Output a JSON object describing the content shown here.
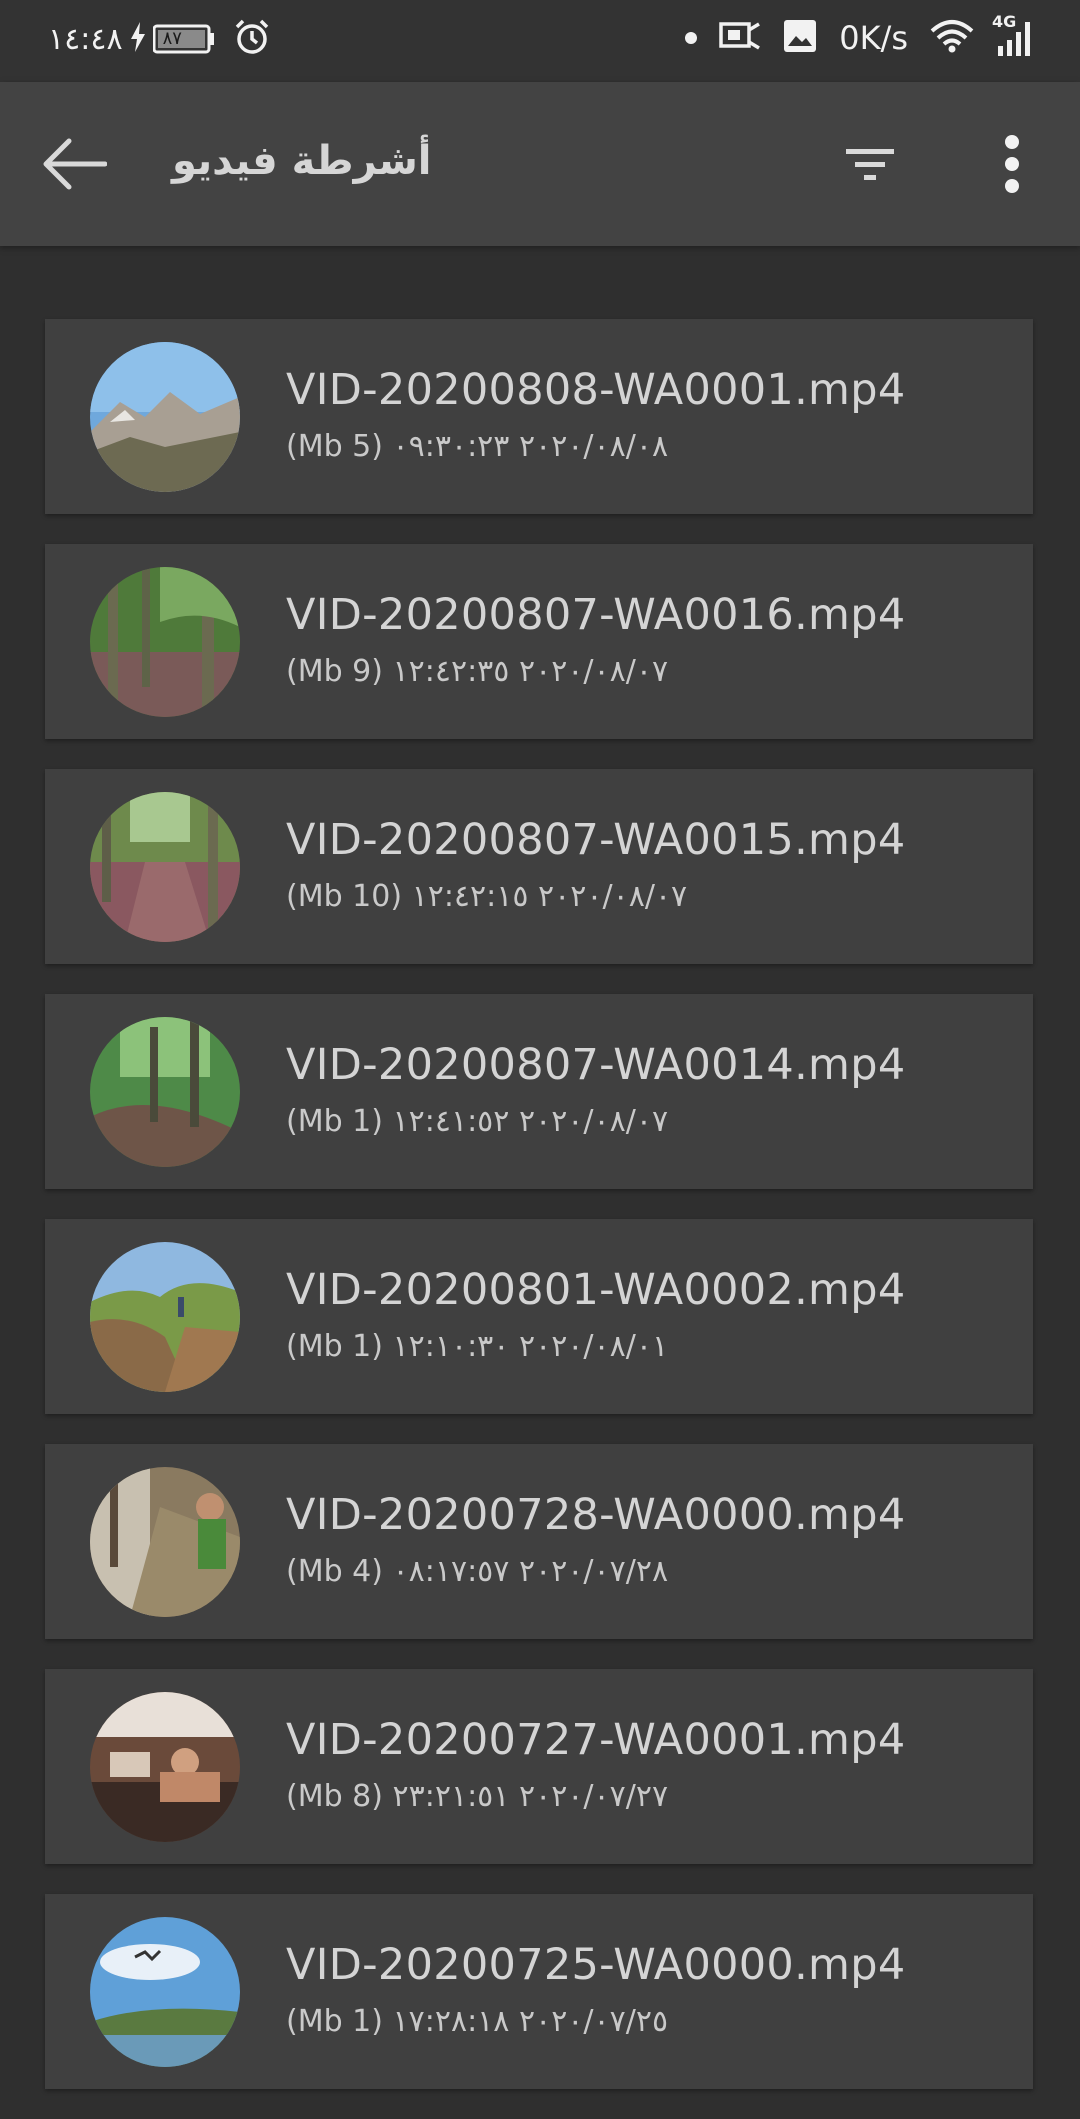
{
  "status_bar": {
    "time": "١٤:٤٨",
    "battery": "٨٧",
    "net_speed": "0K/s",
    "network": "4G",
    "icons": [
      "charging-bolt-icon",
      "battery-icon",
      "alarm-icon",
      "dot-icon",
      "screen-share-icon",
      "image-icon",
      "wifi-icon",
      "cellular-signal-icon"
    ]
  },
  "app_bar": {
    "title": "أشرطة فيديو",
    "back_icon": "arrow-back-icon",
    "filter_icon": "filter-list-icon",
    "more_icon": "more-vert-icon"
  },
  "videos": [
    {
      "name": "VID-20200808-WA0001.mp4",
      "size": "(Mb 5)",
      "datetime": "٢٠٢٠/٠٨/٠٨ ٠٩:٣٠:٢٣",
      "thumb": "mountains"
    },
    {
      "name": "VID-20200807-WA0016.mp4",
      "size": "(Mb 9)",
      "datetime": "٢٠٢٠/٠٨/٠٧ ١٢:٤٢:٣٥",
      "thumb": "forest-trail"
    },
    {
      "name": "VID-20200807-WA0015.mp4",
      "size": "(Mb 10)",
      "datetime": "٢٠٢٠/٠٨/٠٧ ١٢:٤٢:١٥",
      "thumb": "forest-path"
    },
    {
      "name": "VID-20200807-WA0014.mp4",
      "size": "(Mb 1)",
      "datetime": "٢٠٢٠/٠٨/٠٧ ١٢:٤١:٥٢",
      "thumb": "green-forest"
    },
    {
      "name": "VID-20200801-WA0002.mp4",
      "size": "(Mb 1)",
      "datetime": "٢٠٢٠/٠٨/٠١ ١٢:١٠:٣٠",
      "thumb": "dirt-trail"
    },
    {
      "name": "VID-20200728-WA0000.mp4",
      "size": "(Mb 4)",
      "datetime": "٢٠٢٠/٠٧/٢٨ ٠٨:١٧:٥٧",
      "thumb": "indoor-person"
    },
    {
      "name": "VID-20200727-WA0001.mp4",
      "size": "(Mb 8)",
      "datetime": "٢٠٢٠/٠٧/٢٧ ٢٣:٢١:٥١",
      "thumb": "party-room"
    },
    {
      "name": "VID-20200725-WA0000.mp4",
      "size": "(Mb 1)",
      "datetime": "٢٠٢٠/٠٧/٢٥ ١٧:٢٨:١٨",
      "thumb": "lake-sky"
    }
  ],
  "colors": {
    "background": "#2f2f2f",
    "app_bar": "#434343",
    "card": "#404040",
    "text": "#d4d4d4"
  }
}
